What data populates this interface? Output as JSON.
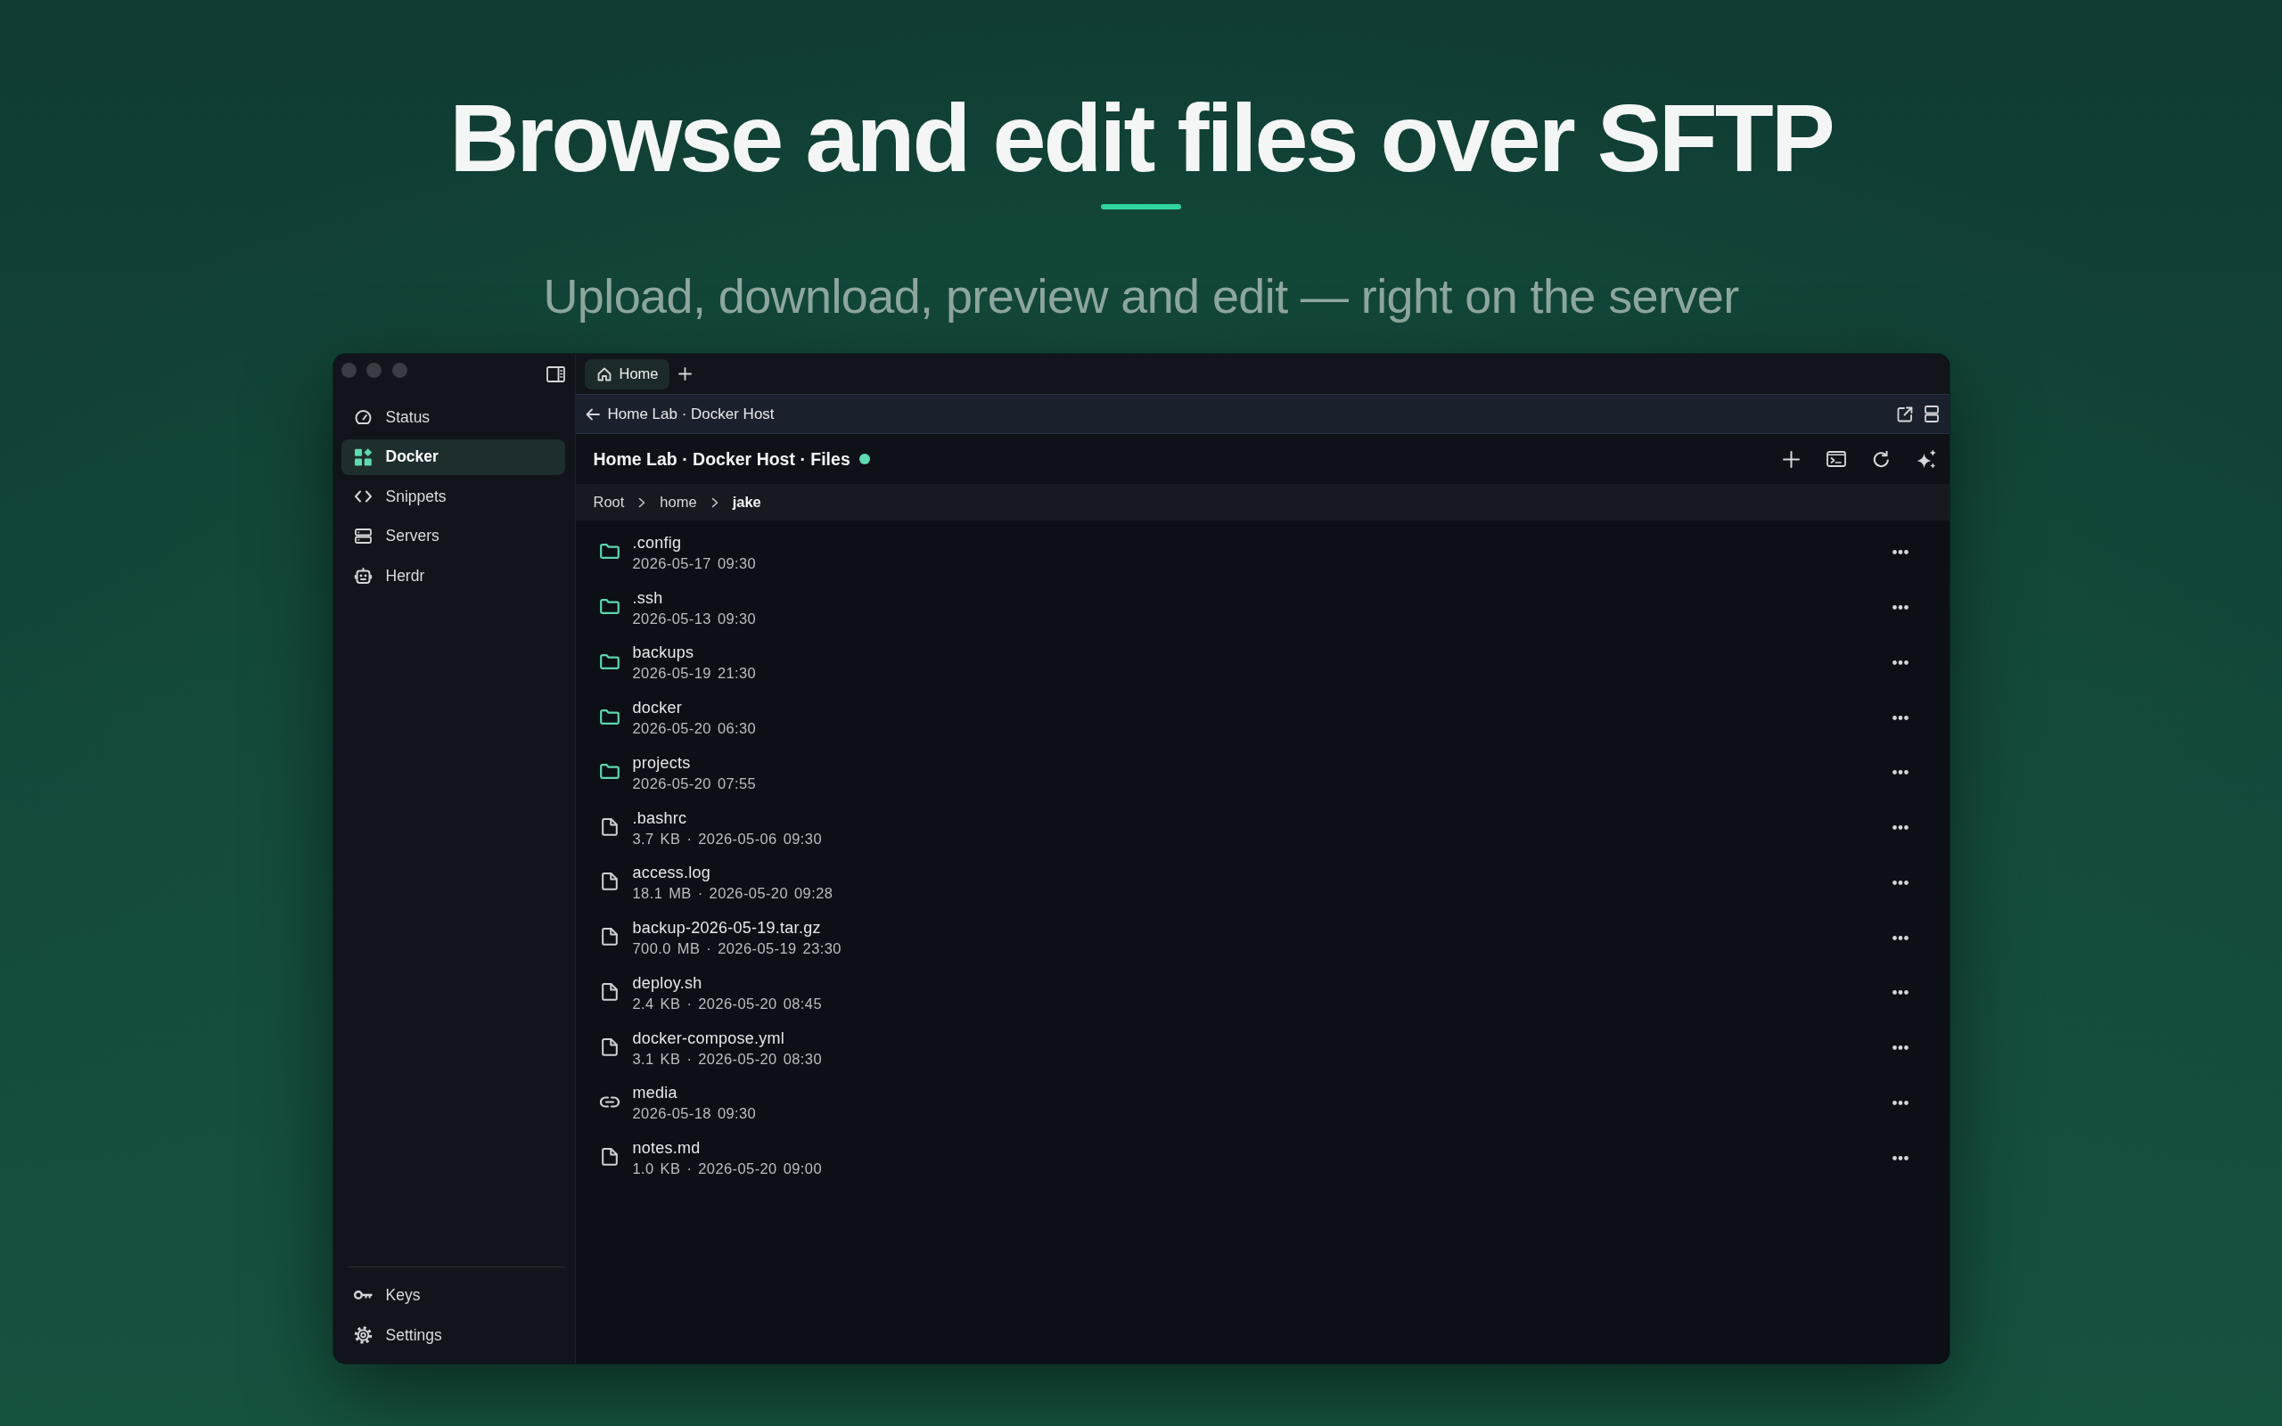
{
  "hero": {
    "title": "Browse and edit files over SFTP",
    "subtitle": "Upload, download, preview and edit — right on the server"
  },
  "sidebar": {
    "items": [
      {
        "label": "Status",
        "selected": false
      },
      {
        "label": "Docker",
        "selected": true
      },
      {
        "label": "Snippets",
        "selected": false
      },
      {
        "label": "Servers",
        "selected": false
      },
      {
        "label": "Herdr",
        "selected": false
      }
    ],
    "footer_items": [
      {
        "label": "Keys"
      },
      {
        "label": "Settings"
      }
    ]
  },
  "tabs": [
    {
      "label": "Home",
      "selected": true
    }
  ],
  "header": {
    "title": "Home Lab · Docker Host"
  },
  "browser": {
    "title": "Home Lab · Docker Host · Files",
    "connected": true,
    "breadcrumbs": [
      {
        "label": "Root",
        "selected": false
      },
      {
        "label": "home",
        "selected": false
      },
      {
        "label": "jake",
        "selected": true
      }
    ],
    "files": [
      {
        "kind": "folder",
        "name": ".config",
        "details": "2026-05-17 09:30"
      },
      {
        "kind": "folder",
        "name": ".ssh",
        "details": "2026-05-13 09:30"
      },
      {
        "kind": "folder",
        "name": "backups",
        "details": "2026-05-19 21:30"
      },
      {
        "kind": "folder",
        "name": "docker",
        "details": "2026-05-20 06:30"
      },
      {
        "kind": "folder",
        "name": "projects",
        "details": "2026-05-20 07:55"
      },
      {
        "kind": "file",
        "name": ".bashrc",
        "details": "3.7 KB · 2026-05-06 09:30"
      },
      {
        "kind": "file",
        "name": "access.log",
        "details": "18.1 MB · 2026-05-20 09:28"
      },
      {
        "kind": "file",
        "name": "backup-2026-05-19.tar.gz",
        "details": "700.0 MB · 2026-05-19 23:30"
      },
      {
        "kind": "file",
        "name": "deploy.sh",
        "details": "2.4 KB · 2026-05-20 08:45"
      },
      {
        "kind": "file",
        "name": "docker-compose.yml",
        "details": "3.1 KB · 2026-05-20 08:30"
      },
      {
        "kind": "link",
        "name": "media",
        "details": "2026-05-18 09:30"
      },
      {
        "kind": "file",
        "name": "notes.md",
        "details": "1.0 KB · 2026-05-20 09:00"
      }
    ]
  }
}
